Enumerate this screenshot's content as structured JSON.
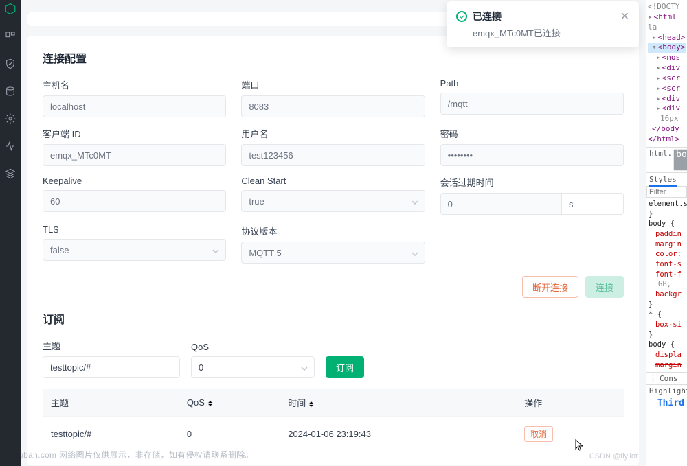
{
  "sidebar_icons": [
    "logo",
    "dashboard",
    "shield",
    "disk",
    "gear",
    "activity",
    "layers"
  ],
  "toast": {
    "title": "已连接",
    "message": "emqx_MTc0MT已连接"
  },
  "conn": {
    "section_title": "连接配置",
    "host": {
      "label": "主机名",
      "value": "localhost"
    },
    "port": {
      "label": "端口",
      "value": "8083"
    },
    "path": {
      "label": "Path",
      "value": "/mqtt"
    },
    "client_id": {
      "label": "客户端 ID",
      "value": "emqx_MTc0MT"
    },
    "username": {
      "label": "用户名",
      "value": "test123456"
    },
    "password": {
      "label": "密码",
      "value": "••••••••"
    },
    "keepalive": {
      "label": "Keepalive",
      "value": "60"
    },
    "clean_start": {
      "label": "Clean Start",
      "value": "true"
    },
    "session_exp": {
      "label": "会话过期时间",
      "value": "0",
      "unit": "s"
    },
    "tls": {
      "label": "TLS",
      "value": "false"
    },
    "proto": {
      "label": "协议版本",
      "value": "MQTT 5"
    },
    "disconnect_btn": "断开连接",
    "connect_btn": "连接"
  },
  "sub": {
    "section_title": "订阅",
    "topic_label": "主题",
    "topic_value": "testtopic/#",
    "qos_label": "QoS",
    "qos_value": "0",
    "subscribe_btn": "订阅",
    "cols": {
      "topic": "主题",
      "qos": "QoS",
      "time": "时间",
      "op": "操作"
    },
    "rows": [
      {
        "topic": "testtopic/#",
        "qos": "0",
        "time": "2024-01-06 23:19:43",
        "op": "取消"
      }
    ]
  },
  "devtools": {
    "filter_placeholder": "Filter",
    "crumb": [
      "html.",
      "bo"
    ],
    "tabs": "Styles",
    "element_style": "element.s",
    "console": "Cons",
    "highlight": "Highlight",
    "third": "Third"
  },
  "watermark": "toymoban.com 网络图片仅供展示，非存储，如有侵权请联系删除。",
  "watermark2": "CSDN @fly.iot"
}
